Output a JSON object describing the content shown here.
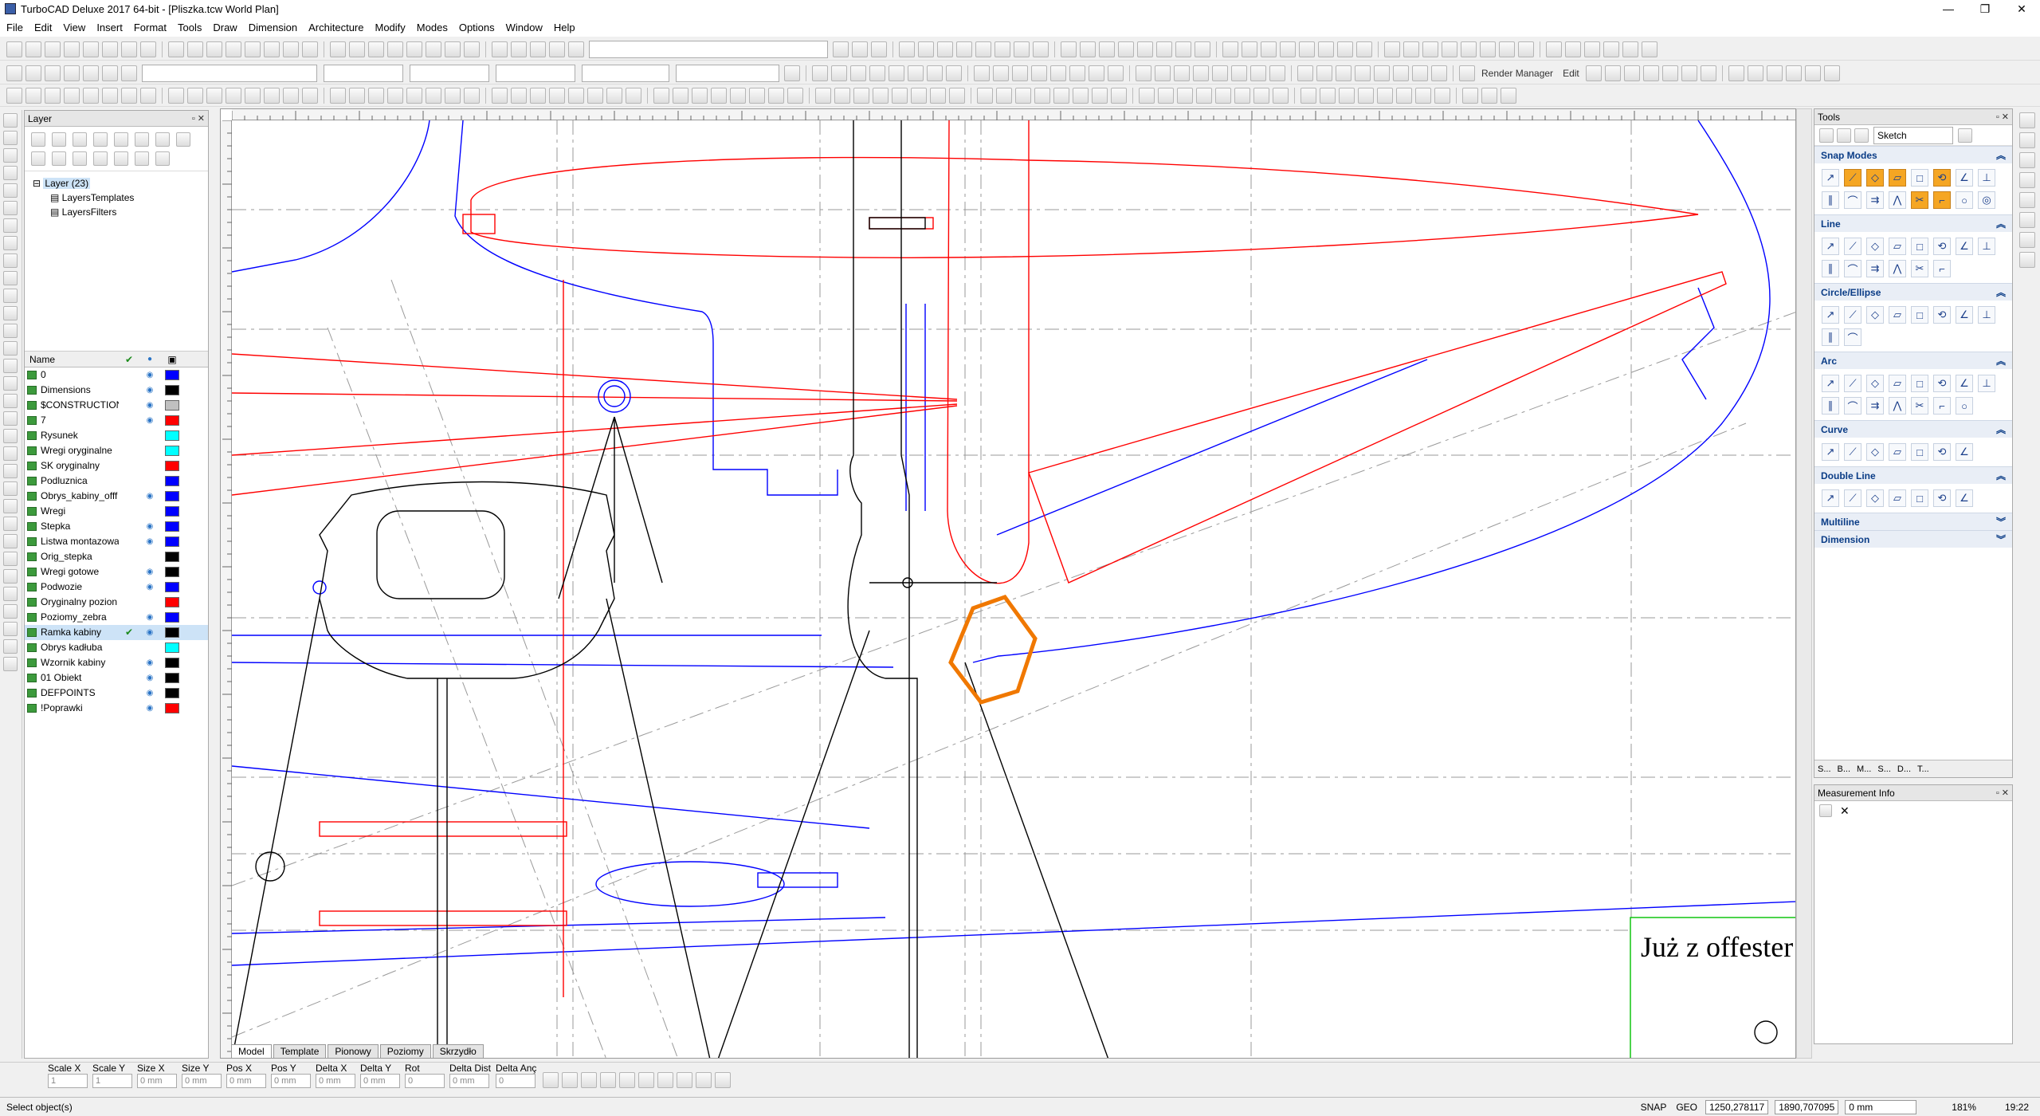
{
  "window": {
    "title": "TurboCAD Deluxe 2017 64-bit - [Pliszka.tcw World Plan]",
    "controls": [
      "—",
      "❐",
      "✕"
    ]
  },
  "menu": [
    "File",
    "Edit",
    "View",
    "Insert",
    "Format",
    "Tools",
    "Draw",
    "Dimension",
    "Architecture",
    "Modify",
    "Modes",
    "Options",
    "Window",
    "Help"
  ],
  "toolbar2": {
    "render_manager": "Render Manager",
    "edit": "Edit"
  },
  "layer_panel": {
    "title": "Layer",
    "tree": [
      {
        "label": "Layer (23)"
      },
      {
        "label": "LayersTemplates"
      },
      {
        "label": "LayersFilters"
      }
    ],
    "columns": {
      "name": "Name"
    },
    "layers": [
      {
        "name": "0",
        "check": "",
        "visible": true,
        "color": "#0000ff"
      },
      {
        "name": "Dimensions",
        "check": "",
        "visible": true,
        "color": "#000000"
      },
      {
        "name": "$CONSTRUCTION",
        "check": "",
        "visible": true,
        "color": "#c0c0c0"
      },
      {
        "name": "7",
        "check": "",
        "visible": true,
        "color": "#ff0000"
      },
      {
        "name": "Rysunek",
        "check": "",
        "visible": false,
        "color": "#00ffff"
      },
      {
        "name": "Wregi oryginalne",
        "check": "",
        "visible": false,
        "color": "#00ffff"
      },
      {
        "name": "SK oryginalny",
        "check": "",
        "visible": false,
        "color": "#ff0000"
      },
      {
        "name": "Podluznica",
        "check": "",
        "visible": false,
        "color": "#0000ff"
      },
      {
        "name": "Obrys_kabiny_offf",
        "check": "",
        "visible": true,
        "color": "#0000ff"
      },
      {
        "name": "Wregi",
        "check": "",
        "visible": false,
        "color": "#0000ff"
      },
      {
        "name": "Stepka",
        "check": "",
        "visible": true,
        "color": "#0000ff"
      },
      {
        "name": "Listwa montazowa",
        "check": "",
        "visible": true,
        "color": "#0000ff"
      },
      {
        "name": "Orig_stepka",
        "check": "",
        "visible": false,
        "color": "#000000"
      },
      {
        "name": "Wregi gotowe",
        "check": "",
        "visible": true,
        "color": "#000000"
      },
      {
        "name": "Podwozie",
        "check": "",
        "visible": true,
        "color": "#0000ff"
      },
      {
        "name": "Oryginalny pozion",
        "check": "",
        "visible": false,
        "color": "#ff0000"
      },
      {
        "name": "Poziomy_zebra",
        "check": "",
        "visible": true,
        "color": "#0000ff"
      },
      {
        "name": "Ramka kabiny",
        "check": "✔",
        "visible": true,
        "color": "#000000",
        "selected": true
      },
      {
        "name": "Obrys kadłuba",
        "check": "",
        "visible": false,
        "color": "#00ffff"
      },
      {
        "name": "Wzornik kabiny",
        "check": "",
        "visible": true,
        "color": "#000000"
      },
      {
        "name": "01 Obiekt",
        "check": "",
        "visible": true,
        "color": "#000000"
      },
      {
        "name": "DEFPOINTS",
        "check": "",
        "visible": true,
        "color": "#000000"
      },
      {
        "name": "!Poprawki",
        "check": "",
        "visible": true,
        "color": "#ff0000"
      }
    ]
  },
  "canvas": {
    "text_note": "Już z offester",
    "tabs": [
      "Model",
      "Template",
      "Pionowy",
      "Poziomy",
      "Skrzydło"
    ]
  },
  "tools_panel": {
    "title": "Tools",
    "palette": "Sketch",
    "sections": [
      {
        "label": "Snap Modes",
        "icons": [
          "snap-vertex",
          "snap-middle",
          "snap-nearest",
          "snap-arc",
          "snap-center",
          "snap-intersection",
          "snap-grid",
          "snap-quadrant",
          "snap-tangent",
          "snap-perpendicular",
          "snap-relative",
          "snap-align",
          "snap-free",
          "snap-rel-grid",
          "snap-drawing-aid",
          "snap-percent"
        ],
        "on": [
          1,
          2,
          3,
          5,
          12,
          13
        ]
      },
      {
        "label": "Line",
        "icons": [
          "line-single",
          "line-multi",
          "line-polygon",
          "line-irregular",
          "line-rectangle",
          "line-rotated",
          "line-angle",
          "line-perp",
          "line-parallel",
          "line-tangent",
          "line-offset",
          "line-bisector",
          "line-split",
          "line-chamfer"
        ],
        "on": []
      },
      {
        "label": "Circle/Ellipse",
        "icons": [
          "circle-center",
          "circle-concentric",
          "circle-2pt",
          "circle-3pt",
          "circle-tangent",
          "circle-tan2",
          "circle-multi",
          "ellipse",
          "ellipse-rotated",
          "ellipse-fixed"
        ],
        "on": []
      },
      {
        "label": "Arc",
        "icons": [
          "arc-center",
          "arc-3pt",
          "arc-tangent",
          "arc-double",
          "arc-concentric",
          "arc-start",
          "arc-end",
          "arc-ellipse",
          "arc-bulge",
          "arc-fillet",
          "arc-quadrant",
          "arc-chord",
          "arc-sector",
          "arc-multi",
          "arc-link"
        ],
        "on": []
      },
      {
        "label": "Curve",
        "icons": [
          "curve-spline",
          "curve-bezier",
          "curve-control",
          "curve-helix",
          "curve-spiral",
          "curve-revision",
          "curve-smooth"
        ],
        "on": []
      },
      {
        "label": "Double Line",
        "icons": [
          "dline-single",
          "dline-multi",
          "dline-circle",
          "dline-rect",
          "dline-polygon",
          "dline-parallel",
          "dline-join"
        ],
        "on": []
      },
      {
        "label": "Multiline",
        "icons": [],
        "on": []
      },
      {
        "label": "Dimension",
        "icons": [],
        "on": []
      }
    ],
    "bottom_tabs": [
      "S...",
      "B...",
      "M...",
      "S...",
      "D...",
      "T..."
    ]
  },
  "measurement_panel": {
    "title": "Measurement Info"
  },
  "inputbar": {
    "fields": [
      {
        "label": "Scale X",
        "value": "1"
      },
      {
        "label": "Scale Y",
        "value": "1"
      },
      {
        "label": "Size X",
        "value": "0 mm"
      },
      {
        "label": "Size Y",
        "value": "0 mm"
      },
      {
        "label": "Pos X",
        "value": "0 mm"
      },
      {
        "label": "Pos Y",
        "value": "0 mm"
      },
      {
        "label": "Delta X",
        "value": "0 mm"
      },
      {
        "label": "Delta Y",
        "value": "0 mm"
      },
      {
        "label": "Rot",
        "value": "0"
      },
      {
        "label": "Delta Dist",
        "value": "0 mm"
      },
      {
        "label": "Delta Anç",
        "value": "0"
      }
    ]
  },
  "status": {
    "prompt": "Select object(s)",
    "snap": "SNAP",
    "geo": "GEO",
    "coord1": "1250,278117",
    "coord2": "1890,707095",
    "dist": "0 mm",
    "zoom": "181%",
    "time": "19:22"
  },
  "colors": {
    "red": "#ff0000",
    "blue": "#0000ff",
    "black": "#000000",
    "orange": "#f07800",
    "green": "#00c000",
    "grey": "#9a9a9a"
  }
}
